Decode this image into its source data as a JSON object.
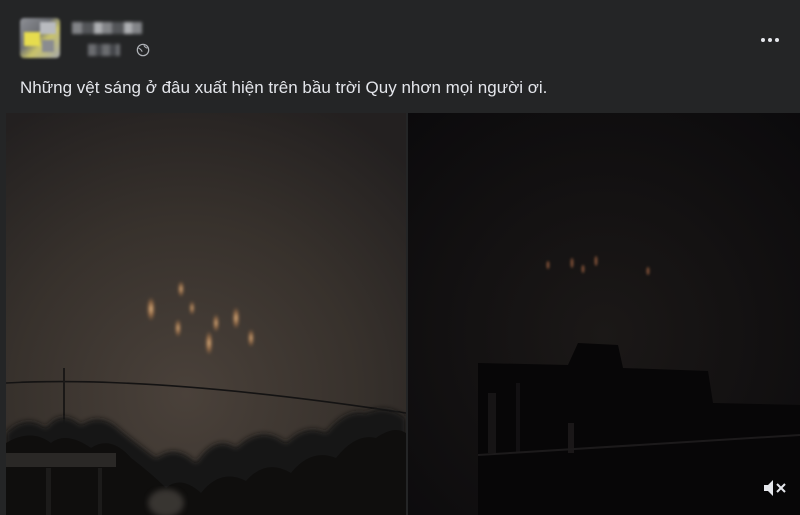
{
  "post": {
    "author_name": "",
    "timestamp": "",
    "privacy_icon": "globe-icon",
    "more_icon": "more-horizontal-icon",
    "text": "Những vệt sáng ở đâu xuất hiện trên bầu trời Quy nhơn mọi người ơi."
  },
  "media": {
    "photos": [
      {
        "description": "photo-left"
      },
      {
        "description": "photo-right"
      }
    ],
    "mute_icon": "speaker-muted-icon"
  },
  "colors": {
    "background": "#242526",
    "text": "#e4e6eb",
    "sky_left": "#3a342e",
    "sky_right": "#0f0e10",
    "light_streak": "#f0b878"
  }
}
